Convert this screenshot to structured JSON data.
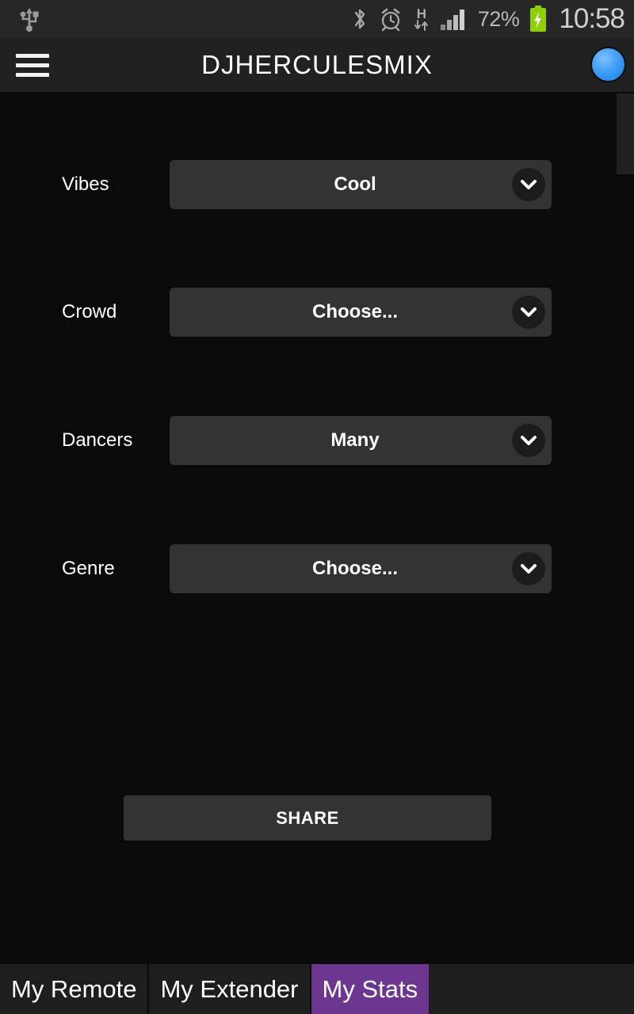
{
  "status_bar": {
    "usb_icon": "usb-icon",
    "bluetooth_icon": "bluetooth-icon",
    "alarm_icon": "alarm-clock-icon",
    "network_type": "H",
    "data_arrows_icon": "data-transfer-arrows-icon",
    "signal_icon": "signal-bars-icon",
    "battery_percent": "72%",
    "battery_icon": "battery-charging-icon",
    "clock": "10:58",
    "colors": {
      "bar_bg": "#272727",
      "icon": "#b0b0b0",
      "battery_green": "#8ecf0a"
    }
  },
  "title_bar": {
    "menu_icon": "hamburger-menu-icon",
    "title": "DJHERCULESMIX",
    "avatar_icon": "user-avatar-icon",
    "colors": {
      "bar_bg": "#212121",
      "avatar": "#4aa3f7"
    }
  },
  "form": {
    "rows": [
      {
        "label": "Vibes",
        "value": "Cool",
        "chevron_icon": "chevron-down-icon"
      },
      {
        "label": "Crowd",
        "value": "Choose...",
        "chevron_icon": "chevron-down-icon"
      },
      {
        "label": "Dancers",
        "value": "Many",
        "chevron_icon": "chevron-down-icon"
      },
      {
        "label": "Genre",
        "value": "Choose...",
        "chevron_icon": "chevron-down-icon"
      }
    ],
    "share_label": "SHARE"
  },
  "scrollbar": {
    "name": "vertical-scrollbar"
  },
  "tab_bar": {
    "tabs": [
      {
        "label": "My Remote",
        "active": false
      },
      {
        "label": "My Extender",
        "active": false
      },
      {
        "label": "My Stats",
        "active": true
      }
    ],
    "active_color": "#6d3791"
  }
}
